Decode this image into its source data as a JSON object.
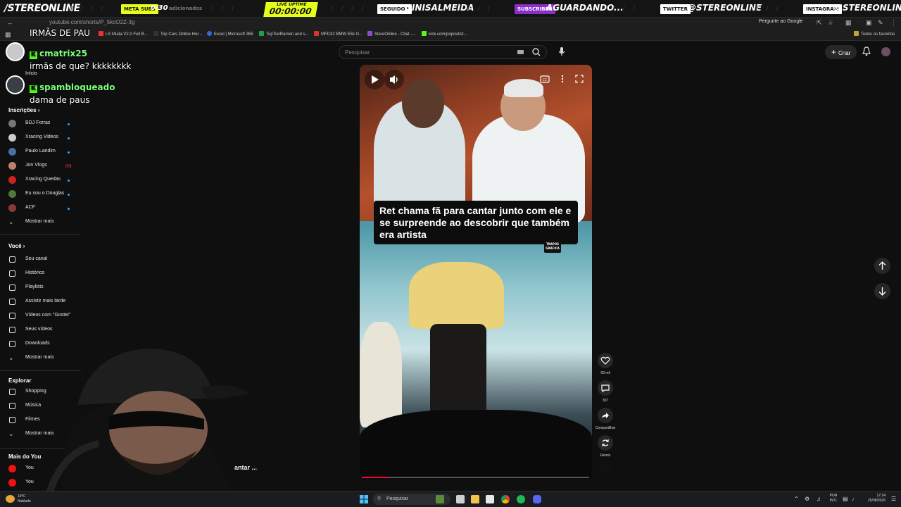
{
  "overlay": {
    "logo": "/STEREONLINE",
    "meta_subs_label": "META SUBS",
    "meta_subs_value": "0/30",
    "meta_subs_extra": "adicionados",
    "uptime_label": "LIVE UPTIME",
    "uptime_value": "00:00:00",
    "seguidor_label": "SEGUIDOR",
    "seguidor_value": "DINISALMEIDA",
    "subscriber_label": "SUBSCRIBER",
    "subscriber_value": "AGUARDANDO...",
    "twitter_label": "TWITTER",
    "twitter_value": "@STEREONLINE",
    "instagram_label": "INSTAGRAM",
    "instagram_value": "@STEREONLINE",
    "colors": {
      "uptime": "#e6ff1a",
      "meta": "#e6ff1a",
      "subscriber": "#8b2fc9"
    }
  },
  "browser": {
    "url": "youtube.com/shorts/P_5kcO2Z-3g",
    "ask_google": "Pergunte ao Google",
    "bookmarks": [
      "LS Miata V2.0 Full B...",
      "Top Cars Online Hor...",
      "Excel | Microsoft 365",
      "TopTierRamen and s...",
      "MFD32 BMW E8x G...",
      "StereOnline - Chat -...",
      "kick.com/popout/st..."
    ],
    "all_favorites": "Todos os favoritos"
  },
  "header": {
    "search_placeholder": "Pesquisar",
    "create_label": "Criar"
  },
  "sidebar": {
    "home_label": "Início",
    "subscriptions_title": "Inscrições",
    "subscriptions": [
      {
        "name": "BDJ Forras",
        "marker": "dot",
        "color": "#777777"
      },
      {
        "name": "Xracing Videos",
        "marker": "dot",
        "color": "#cccccc"
      },
      {
        "name": "Paulo Landim",
        "marker": "dot",
        "color": "#4a6fa0"
      },
      {
        "name": "Jon Vlogs",
        "marker": "live",
        "color": "#b9826a"
      },
      {
        "name": "Xracing Quedas",
        "marker": "dot",
        "color": "#cc2222"
      },
      {
        "name": "Eu sou o Douglas",
        "marker": "dot",
        "color": "#4c7a3a"
      },
      {
        "name": "ACF",
        "marker": "dot",
        "color": "#8a3a3a"
      }
    ],
    "show_more": "Mostrar mais",
    "you_title": "Você",
    "you_items": [
      {
        "label": "Seu canal",
        "icon": "user-square-icon"
      },
      {
        "label": "Histórico",
        "icon": "history-icon"
      },
      {
        "label": "Playlists",
        "icon": "playlist-icon"
      },
      {
        "label": "Assistir mais tarde",
        "icon": "clock-icon"
      },
      {
        "label": "Vídeos com \"Gostei\"",
        "icon": "thumb-up-icon"
      },
      {
        "label": "Seus vídeos",
        "icon": "video-icon"
      },
      {
        "label": "Downloads",
        "icon": "download-icon"
      }
    ],
    "you_show_more": "Mostrar mais",
    "explore_title": "Explorar",
    "explore_items": [
      {
        "label": "Shopping",
        "icon": "shopping-icon"
      },
      {
        "label": "Música",
        "icon": "music-icon"
      },
      {
        "label": "Filmes",
        "icon": "film-icon"
      }
    ],
    "explore_show_more": "Mostrar mais",
    "more_title": "Mais do You",
    "more_items": [
      "You",
      "You"
    ]
  },
  "chat": [
    {
      "user": "",
      "text": "IRMÃS DE PAU"
    },
    {
      "user": "cmatrix25",
      "text": "irmãs de que? kkkkkkkk"
    },
    {
      "user": "spambloqueado",
      "text": "dama de paus"
    }
  ],
  "short": {
    "caption": "Ret chama fã para cantar junto com ele e se surpreende ao descobrir que também era artista",
    "badge_text": "TRAPOS GRÁFICA",
    "progress": 0.12,
    "likes": "69 mil",
    "comments": "307",
    "share_label": "Compartilhar",
    "remix_label": "Remix",
    "overlap_text": "antar ..."
  },
  "taskbar": {
    "weather_temp": "19°C",
    "weather_desc": "Nublado",
    "search_label": "Pesquisar",
    "lang_top": "POR",
    "lang_bottom": "INTL",
    "time": "17:24",
    "date": "25/08/2026"
  }
}
